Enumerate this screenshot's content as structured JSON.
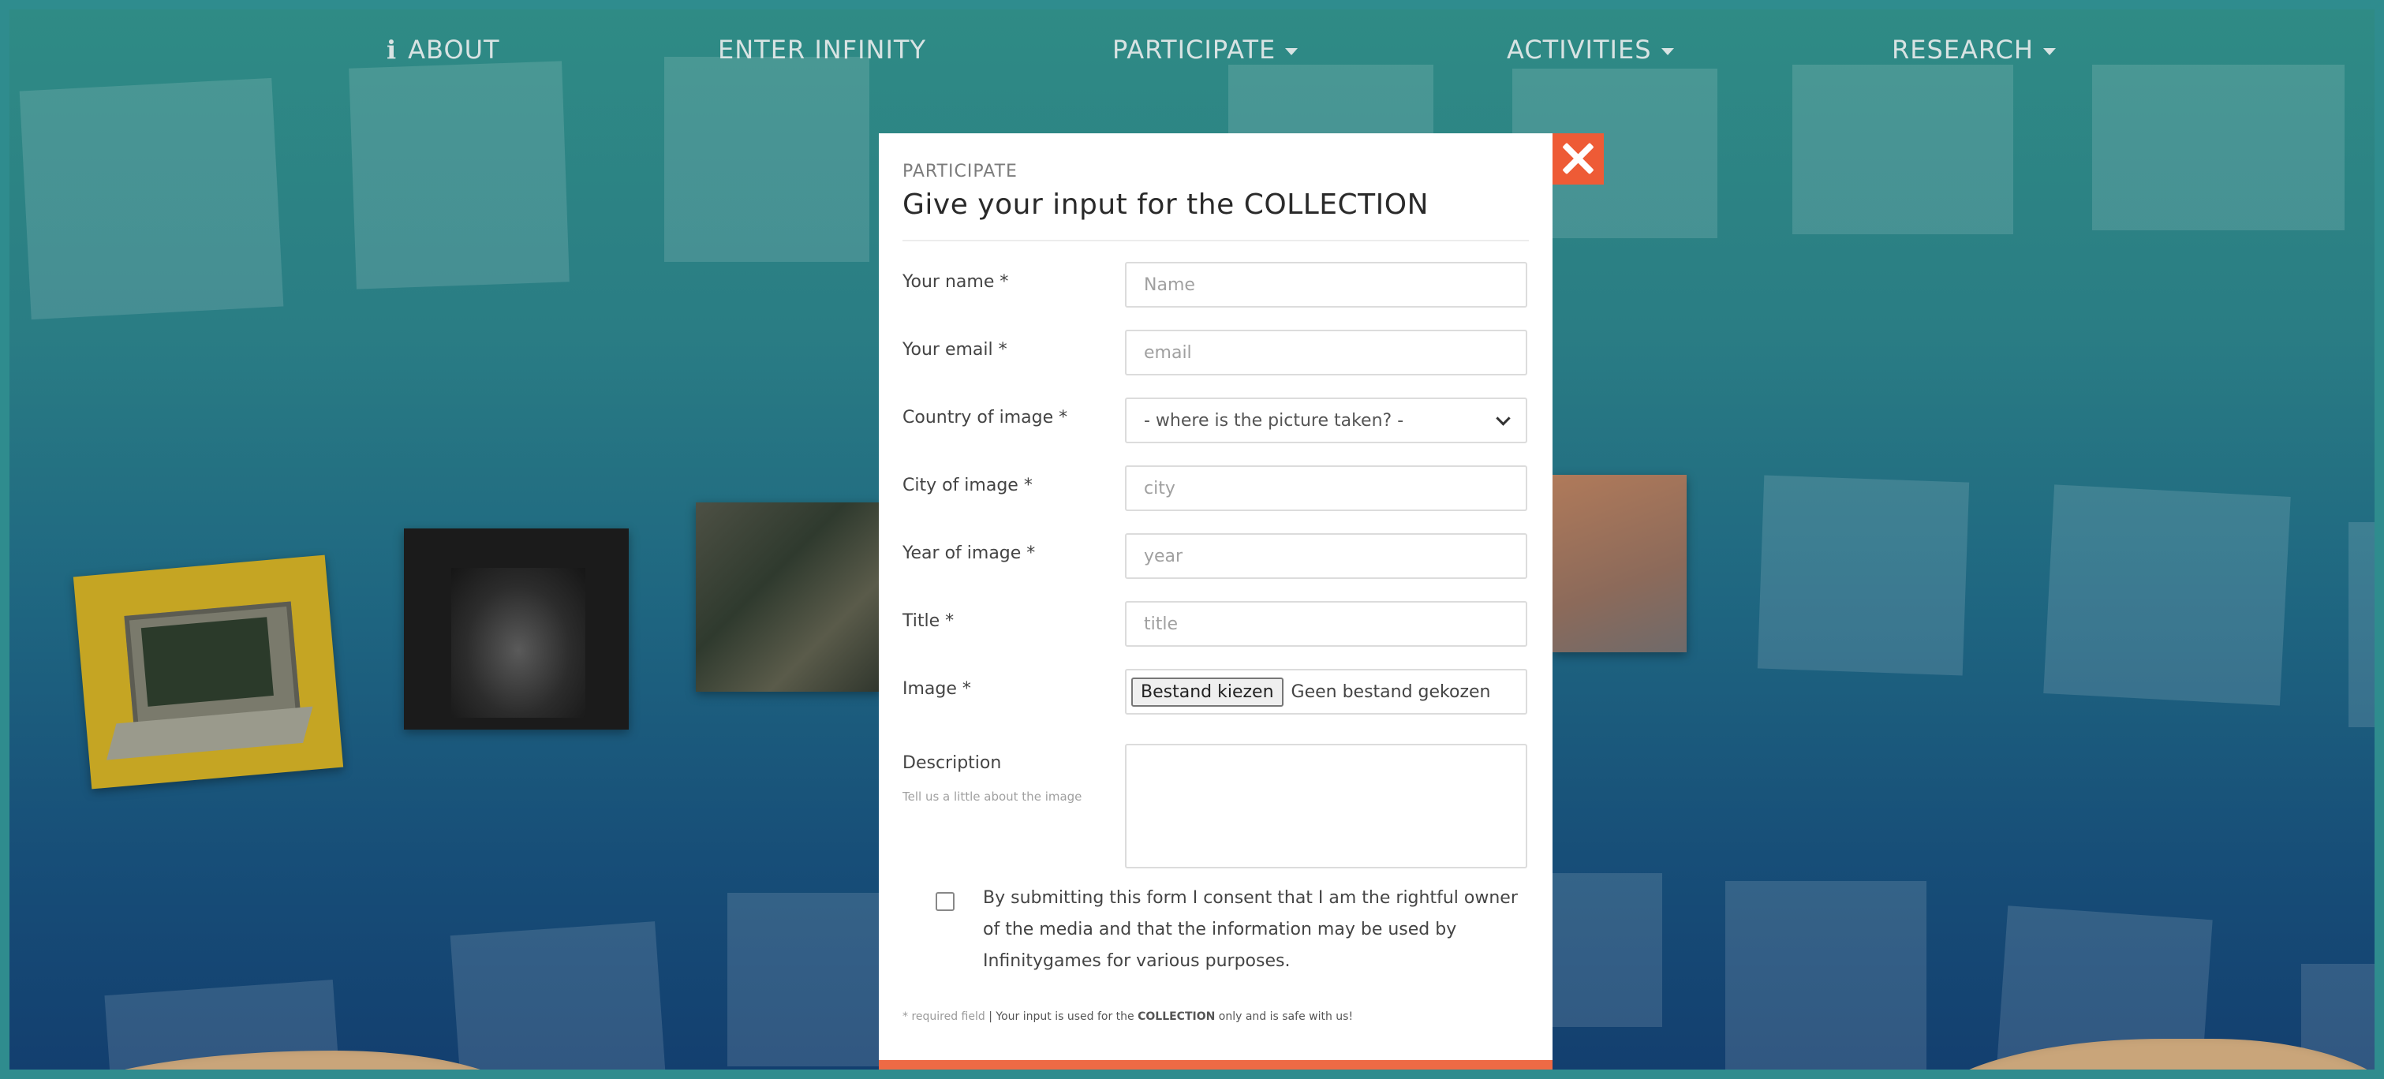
{
  "nav": {
    "about_icon": "i",
    "about": "ABOUT",
    "enter": "ENTER INFINITY",
    "participate": "PARTICIPATE",
    "activities": "ACTIVITIES",
    "research": "RESEARCH"
  },
  "modal": {
    "kicker": "PARTICIPATE",
    "title": "Give your input for the COLLECTION",
    "fields": {
      "name_label": "Your name *",
      "name_placeholder": "Name",
      "email_label": "Your email *",
      "email_placeholder": "email",
      "country_label": "Country of image *",
      "country_value": "- where is the picture taken? -",
      "city_label": "City of image *",
      "city_placeholder": "city",
      "year_label": "Year of image *",
      "year_placeholder": "year",
      "title_label": "Title *",
      "title_placeholder": "title",
      "image_label": "Image *",
      "file_button": "Bestand kiezen",
      "file_status": "Geen bestand gekozen",
      "description_label": "Description",
      "description_hint": "Tell us a little about the image"
    },
    "consent": "By submitting this form I consent that I am the rightful owner of the media and that the information may be used by Infinitygames for various purposes.",
    "footer": {
      "required": "* required field",
      "sep": "|",
      "pre": "Your input is used for the",
      "collection": "COLLECTION",
      "post": "only and is safe with us!"
    }
  },
  "colors": {
    "accent": "#ee5b36",
    "frame": "#2f8c8e"
  },
  "icons": {
    "close": "close-icon",
    "dropdown": "chevron-down-icon",
    "info": "info-icon"
  }
}
